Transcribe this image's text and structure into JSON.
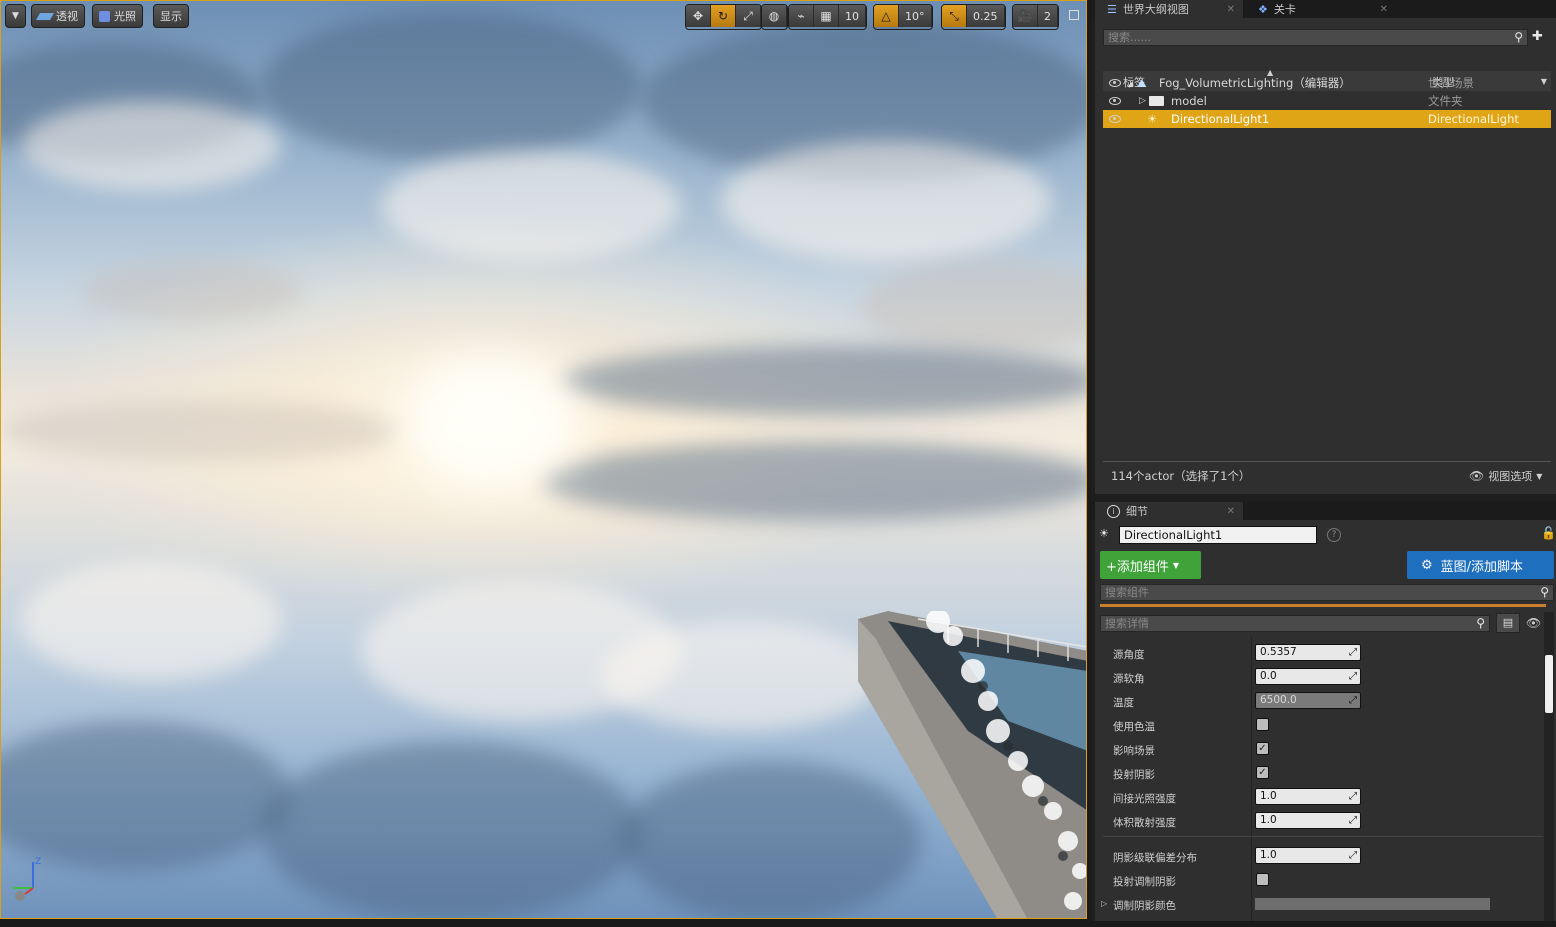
{
  "viewport": {
    "toolbar": {
      "perspective_label": "透视",
      "lighting_label": "光照",
      "show_label": "显示",
      "grid_snap_value": "10",
      "rotation_snap_value": "10°",
      "scale_snap_value": "0.25",
      "camera_speed_value": "2"
    },
    "axis": {
      "z": "Z"
    }
  },
  "outliner": {
    "tab_title": "世界大纲视图",
    "tab2_title": "关卡",
    "search_placeholder": "搜索......",
    "col_label": "标签",
    "col_type": "类型",
    "rows": [
      {
        "label": "Fog_VolumetricLighting（编辑器）",
        "type": "世界场景"
      },
      {
        "label": "model",
        "type": "文件夹"
      },
      {
        "label": "DirectionalLight1",
        "type": "DirectionalLight"
      }
    ],
    "status": "114个actor（选择了1个）",
    "view_options": "视图选项"
  },
  "details": {
    "tab_title": "细节",
    "actor_name": "DirectionalLight1",
    "add_component": "+添加组件",
    "blueprint_button": "蓝图/添加脚本",
    "search_components_placeholder": "搜索组件",
    "search_details_placeholder": "搜索详情",
    "props": [
      {
        "label": "源角度",
        "value": "0.5357",
        "kind": "num"
      },
      {
        "label": "源软角",
        "value": "0.0",
        "kind": "num"
      },
      {
        "label": "温度",
        "value": "6500.0",
        "kind": "num-dim"
      },
      {
        "label": "使用色温",
        "value": "",
        "kind": "check-off"
      },
      {
        "label": "影响场景",
        "value": "✓",
        "kind": "check-on"
      },
      {
        "label": "投射阴影",
        "value": "✓",
        "kind": "check-on"
      },
      {
        "label": "间接光照强度",
        "value": "1.0",
        "kind": "num"
      },
      {
        "label": "体积散射强度",
        "value": "1.0",
        "kind": "num"
      }
    ],
    "props2": [
      {
        "label": "阴影级联偏差分布",
        "value": "1.0",
        "kind": "num"
      },
      {
        "label": "投射调制阴影",
        "value": "",
        "kind": "check-off"
      },
      {
        "label": "调制阴影颜色",
        "value": "",
        "kind": "color"
      }
    ]
  }
}
